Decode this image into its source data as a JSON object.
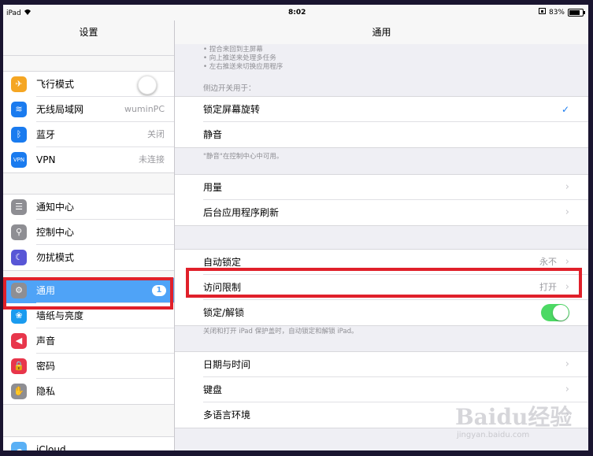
{
  "status": {
    "device": "iPad",
    "time": "8:02",
    "battery": "83%"
  },
  "sidebar": {
    "title": "设置",
    "groups": [
      [
        {
          "label": "飞行模式",
          "icon": "airplane-icon",
          "color": "#f5a623",
          "value": ""
        },
        {
          "label": "无线局域网",
          "icon": "wifi-icon",
          "color": "#1a7bef",
          "value": "wuminPC"
        },
        {
          "label": "蓝牙",
          "icon": "bluetooth-icon",
          "color": "#1a7bef",
          "value": "关闭"
        },
        {
          "label": "VPN",
          "icon": "vpn-icon",
          "color": "#1a7bef",
          "value": "未连接"
        }
      ],
      [
        {
          "label": "通知中心",
          "icon": "notification-icon",
          "color": "#8e8e93",
          "value": ""
        },
        {
          "label": "控制中心",
          "icon": "control-center-icon",
          "color": "#8e8e93",
          "value": ""
        },
        {
          "label": "勿扰模式",
          "icon": "moon-icon",
          "color": "#5856d6",
          "value": ""
        }
      ],
      [
        {
          "label": "通用",
          "icon": "gear-icon",
          "color": "#8e8e93",
          "value": "",
          "badge": "1",
          "selected": true
        },
        {
          "label": "墙纸与亮度",
          "icon": "wallpaper-icon",
          "color": "#1a9bef",
          "value": ""
        },
        {
          "label": "声音",
          "icon": "speaker-icon",
          "color": "#e8364b",
          "value": ""
        },
        {
          "label": "密码",
          "icon": "lock-icon",
          "color": "#e8364b",
          "value": ""
        },
        {
          "label": "隐私",
          "icon": "hand-icon",
          "color": "#8e8e93",
          "value": ""
        }
      ],
      [
        {
          "label": "iCloud",
          "icon": "icloud-icon",
          "color": "#5ab0f5",
          "value": ""
        }
      ]
    ]
  },
  "main": {
    "title": "通用",
    "gesture_notes": [
      "• 捏合来回到主屏幕",
      "• 向上推送来处理多任务",
      "• 左右推送来切换应用程序"
    ],
    "side_switch_header": "侧边开关用于：",
    "side_switch_items": [
      "锁定屏幕旋转",
      "静音"
    ],
    "mute_note": "\"静音\"在控制中心中可用。",
    "group2": [
      "用量",
      "后台应用程序刷新"
    ],
    "auto_lock": {
      "label": "自动锁定",
      "value": "永不"
    },
    "restrictions": {
      "label": "访问限制",
      "value": "打开"
    },
    "lock_unlock": {
      "label": "锁定/解锁"
    },
    "lock_note": "关闭和打开 iPad 保护盖时，自动锁定和解锁 iPad。",
    "group4": [
      "日期与时间",
      "键盘",
      "多语言环境"
    ]
  },
  "watermark": {
    "brand": "Baidu经验",
    "url": "jingyan.baidu.com"
  },
  "colors": {
    "highlight": "#e0202a",
    "selected": "#4fa3f7",
    "switch_on": "#4cd964"
  }
}
